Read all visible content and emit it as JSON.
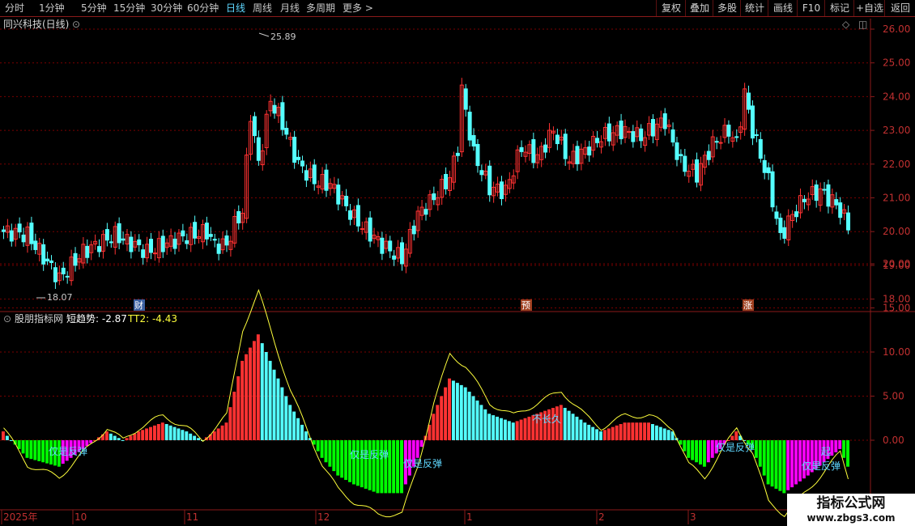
{
  "toolbar": {
    "periods": [
      "分时",
      "1分钟",
      "5分钟",
      "15分钟",
      "30分钟",
      "60分钟",
      "日线",
      "周线",
      "月线",
      "多周期",
      "更多 >"
    ],
    "active_period": "日线",
    "actions": [
      "复权",
      "叠加",
      "多股",
      "统计",
      "画线",
      "F10",
      "标记",
      "+自选",
      "返回"
    ]
  },
  "main": {
    "stock_title": "同兴科技(日线)",
    "y_ticks": [
      "26.00",
      "25.00",
      "24.00",
      "23.00",
      "22.00",
      "21.00",
      "20.00",
      "19.00",
      "18.00"
    ],
    "high_label": "25.89",
    "low_label": "18.07",
    "event_markers": [
      "财",
      "预",
      "涨"
    ]
  },
  "indicator": {
    "name": "股朋指标网",
    "series1_label": "短趋势: -2.87",
    "series2_label": "TT2: -4.43",
    "y_ticks": [
      "20.00",
      "15.00",
      "10.00",
      "5.00",
      "0.00"
    ],
    "annotations": [
      "仅是反弹",
      "仅是反弹",
      "仅是反弹",
      "不长久",
      "仅是反弹",
      "仅是反弹",
      "起"
    ]
  },
  "x_axis": {
    "labels": [
      "2025年",
      "10",
      "11",
      "12",
      "1",
      "2",
      "3"
    ]
  },
  "watermark": {
    "title": "指标公式网",
    "url": "www.zbgs3.com"
  },
  "colors": {
    "up": "#ff3232",
    "down": "#54ffff",
    "grid": "#7a0000",
    "magenta": "#ff00ff",
    "green": "#00ff00",
    "yellow": "#ffff3c"
  }
}
